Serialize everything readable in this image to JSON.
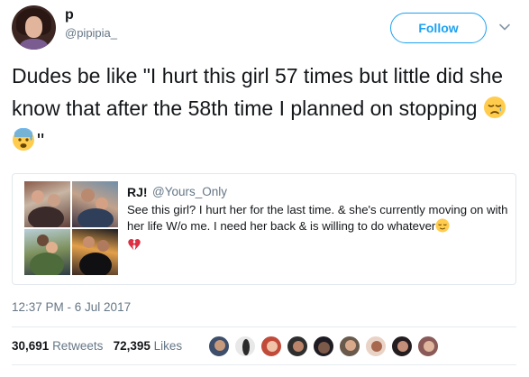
{
  "author": {
    "display_name": "p",
    "handle": "@pipipia_",
    "follow_label": "Follow"
  },
  "tweet": {
    "text": "Dudes be like \"I hurt this girl 57 times but little did she know that after the 58th time I planned on stopping ",
    "closing_quote": "\"",
    "emojis": [
      "disappointed-relieved-face",
      "anxious-sweat-face"
    ]
  },
  "quoted_tweet": {
    "name": "RJ!",
    "handle": "@Yours_Only",
    "body": "See this girl? I hurt her for the last time. & she's currently moving on with her life W/o me. I need her back & is willing to do whatever",
    "emojis": [
      "relieved-face",
      "broken-heart"
    ]
  },
  "timestamp": "12:37 PM - 6 Jul 2017",
  "stats": {
    "retweets_count": "30,691",
    "retweets_label": "Retweets",
    "likes_count": "72,395",
    "likes_label": "Likes"
  },
  "colors": {
    "accent": "#1da1f2",
    "text": "#14171a",
    "muted": "#657786",
    "border": "#e1e8ed"
  }
}
